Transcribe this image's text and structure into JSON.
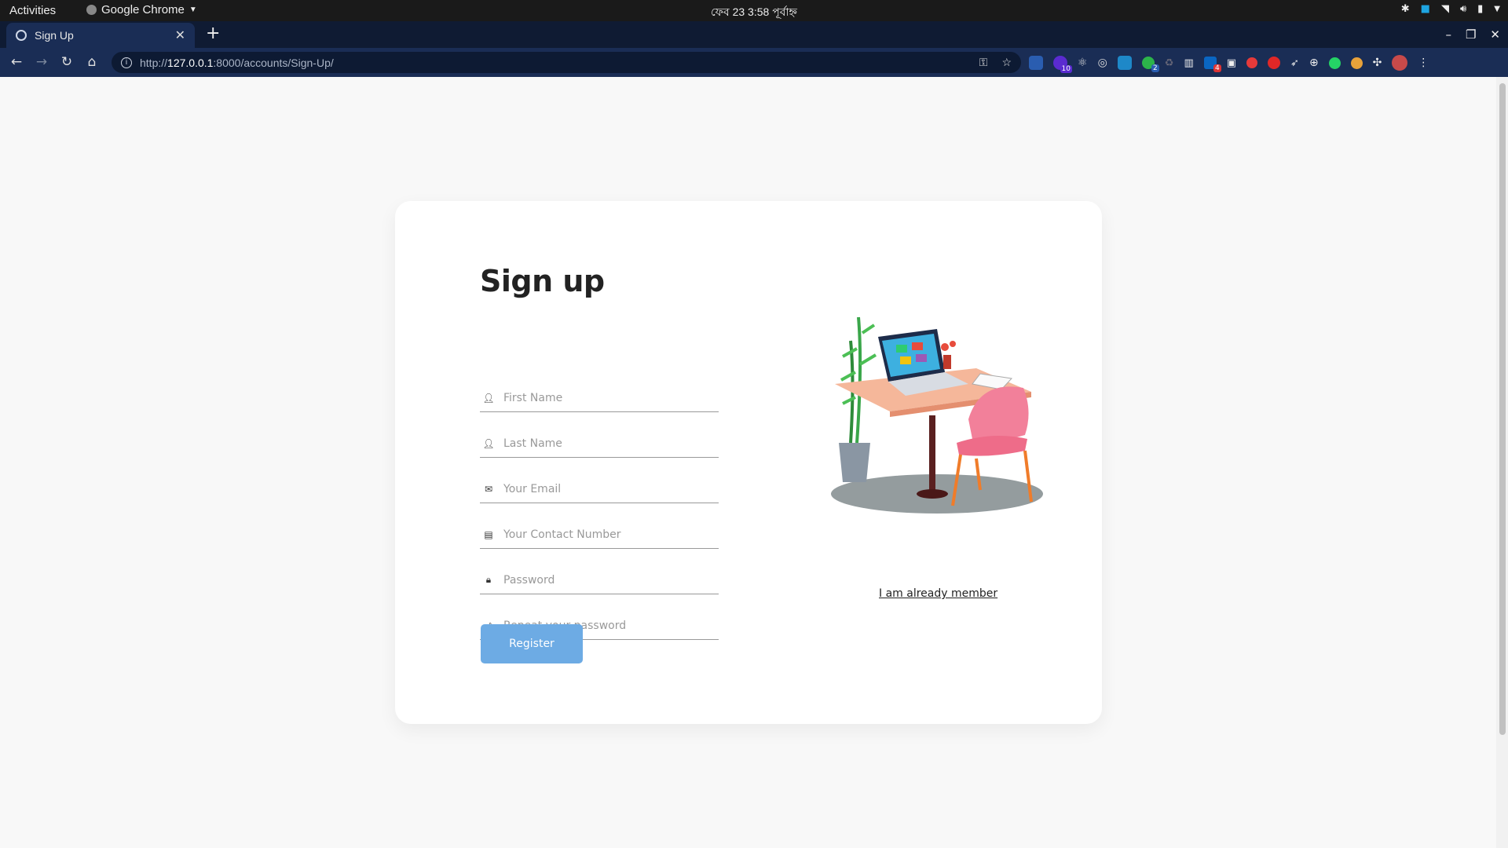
{
  "system_bar": {
    "activities": "Activities",
    "app_name": "Google Chrome",
    "clock": "ফেব 23   3:58 পূর্বাহ্ন"
  },
  "browser": {
    "tab_title": "Sign Up",
    "url_scheme": "http://",
    "url_host": "127.0.0.1",
    "url_path": ":8000/accounts/Sign-Up/",
    "extension_badges": {
      "badge_a": "10",
      "badge_b": "2",
      "badge_c": "4"
    }
  },
  "form": {
    "title": "Sign up",
    "fields": [
      {
        "placeholder": "First Name",
        "icon": "person-icon"
      },
      {
        "placeholder": "Last Name",
        "icon": "person-icon"
      },
      {
        "placeholder": "Your Email",
        "icon": "envelope-icon"
      },
      {
        "placeholder": "Your Contact Number",
        "icon": "contact-card-icon"
      },
      {
        "placeholder": "Password",
        "icon": "lock-icon"
      },
      {
        "placeholder": "Repeat your password",
        "icon": "lock-outline-icon"
      }
    ],
    "register_label": "Register",
    "member_link": "I am already member"
  },
  "colors": {
    "button": "#6dabe4",
    "tab_strip": "#0f1b33",
    "toolbar": "#1a2d55"
  }
}
